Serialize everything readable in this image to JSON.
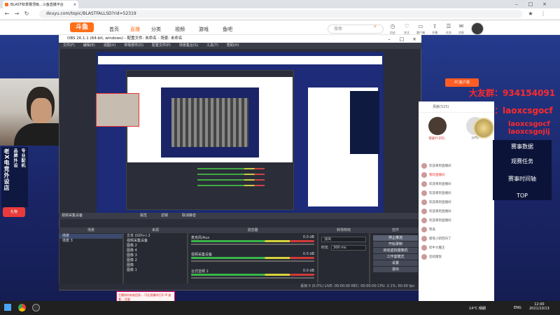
{
  "browser": {
    "tab_title": "BLAST秋季赛顶级...斗鱼直播平台",
    "url": "douyu.com/topic/BLASTFALLSD?rid=52319",
    "window_controls": [
      "minimize-icon",
      "maximize-icon",
      "close-icon"
    ]
  },
  "douyu": {
    "logo": "斗鱼",
    "nav": [
      "首页",
      "直播",
      "分类",
      "视频",
      "游戏",
      "鱼吧"
    ],
    "search_placeholder": "搜索",
    "header_icons": [
      {
        "icon": "history-icon",
        "label": "历史"
      },
      {
        "icon": "follow-icon",
        "label": "关注"
      },
      {
        "icon": "client-icon",
        "label": "客户端"
      },
      {
        "icon": "upload-icon",
        "label": "开播"
      },
      {
        "icon": "task-icon",
        "label": "任务"
      },
      {
        "icon": "message-icon",
        "label": "消息"
      }
    ],
    "pc_client_button": "PC客户端",
    "ad_red_lines": [
      "大友群：934154091",
      "大行动：laoxcsgocf",
      "laoxcsgocf",
      "laoxcsgojij"
    ],
    "rank_items": [
      "赛事数据",
      "观赛任务",
      "赛事时间轴",
      "TOP"
    ],
    "contribution_tab": "贡献(525)",
    "chat_lines": [
      "欢迎来到直播间",
      "我的直播间",
      "欢迎来到直播间",
      "欢迎来到直播间",
      "欢迎来到直播间",
      "欢迎来到直播间",
      "欢迎来到直播间",
      "赞美",
      "蜡笔小新回归了",
      "奶牛大魔王",
      "连续蹭饭"
    ],
    "contributors": [
      "我爱叶子的..",
      "Jeffy"
    ]
  },
  "left_panel": {
    "vertical_texts": [
      "老X电竞外设店",
      "品牌外设",
      "专业配机"
    ],
    "badge": "礼物"
  },
  "obs": {
    "title": "OBS 26.1.1 (64-bit, windows) - 配置文件: 未命名 - 场景: 未命名",
    "menu": [
      "文件(F)",
      "编辑(E)",
      "视图(V)",
      "停靠部件(D)",
      "配置文件(P)",
      "场景集合(S)",
      "工具(T)",
      "帮助(H)"
    ],
    "source_toolbar": [
      "属性",
      "滤镜",
      "取消静音"
    ],
    "docks": {
      "scenes_header": "场景",
      "sources_header": "来源",
      "mixer_header": "混音器",
      "transitions_header": "转场特效",
      "controls_header": "控件"
    },
    "scenes": [
      "场景",
      "场景 3"
    ],
    "sources": [
      "文本 (GDI+) 2",
      "视频采集设备",
      "图像 2",
      "图像 4",
      "图像 3",
      "图像 2",
      "图像",
      "图像 1"
    ],
    "mixer_channels": [
      {
        "name": "麦克风/Aux",
        "db": "0.0 dB"
      },
      {
        "name": "视频采集设备",
        "db": "0.0 dB"
      },
      {
        "name": "台式音频 2",
        "db": "0.0 dB"
      }
    ],
    "transition": {
      "type": "淡出",
      "duration_label": "时长",
      "duration": "300 ms"
    },
    "controls": [
      "停止推流",
      "开始录制",
      "启动虚拟摄像机",
      "工作室模式",
      "设置",
      "退出"
    ],
    "status": "丢帧 0 (0.0%)  LIVE: 00:00:00  REC: 00:00:00  CPU: 2.1%, 60.00 fps",
    "scene_src_label": "视频采集设备"
  },
  "toast": "主播如何有效回答... 可在直播间打开 IP 查看... 回复",
  "taskbar": {
    "weather": "14°C 晴朗",
    "lang": "ENG",
    "time": "12:00",
    "date": "2021/10/13"
  }
}
